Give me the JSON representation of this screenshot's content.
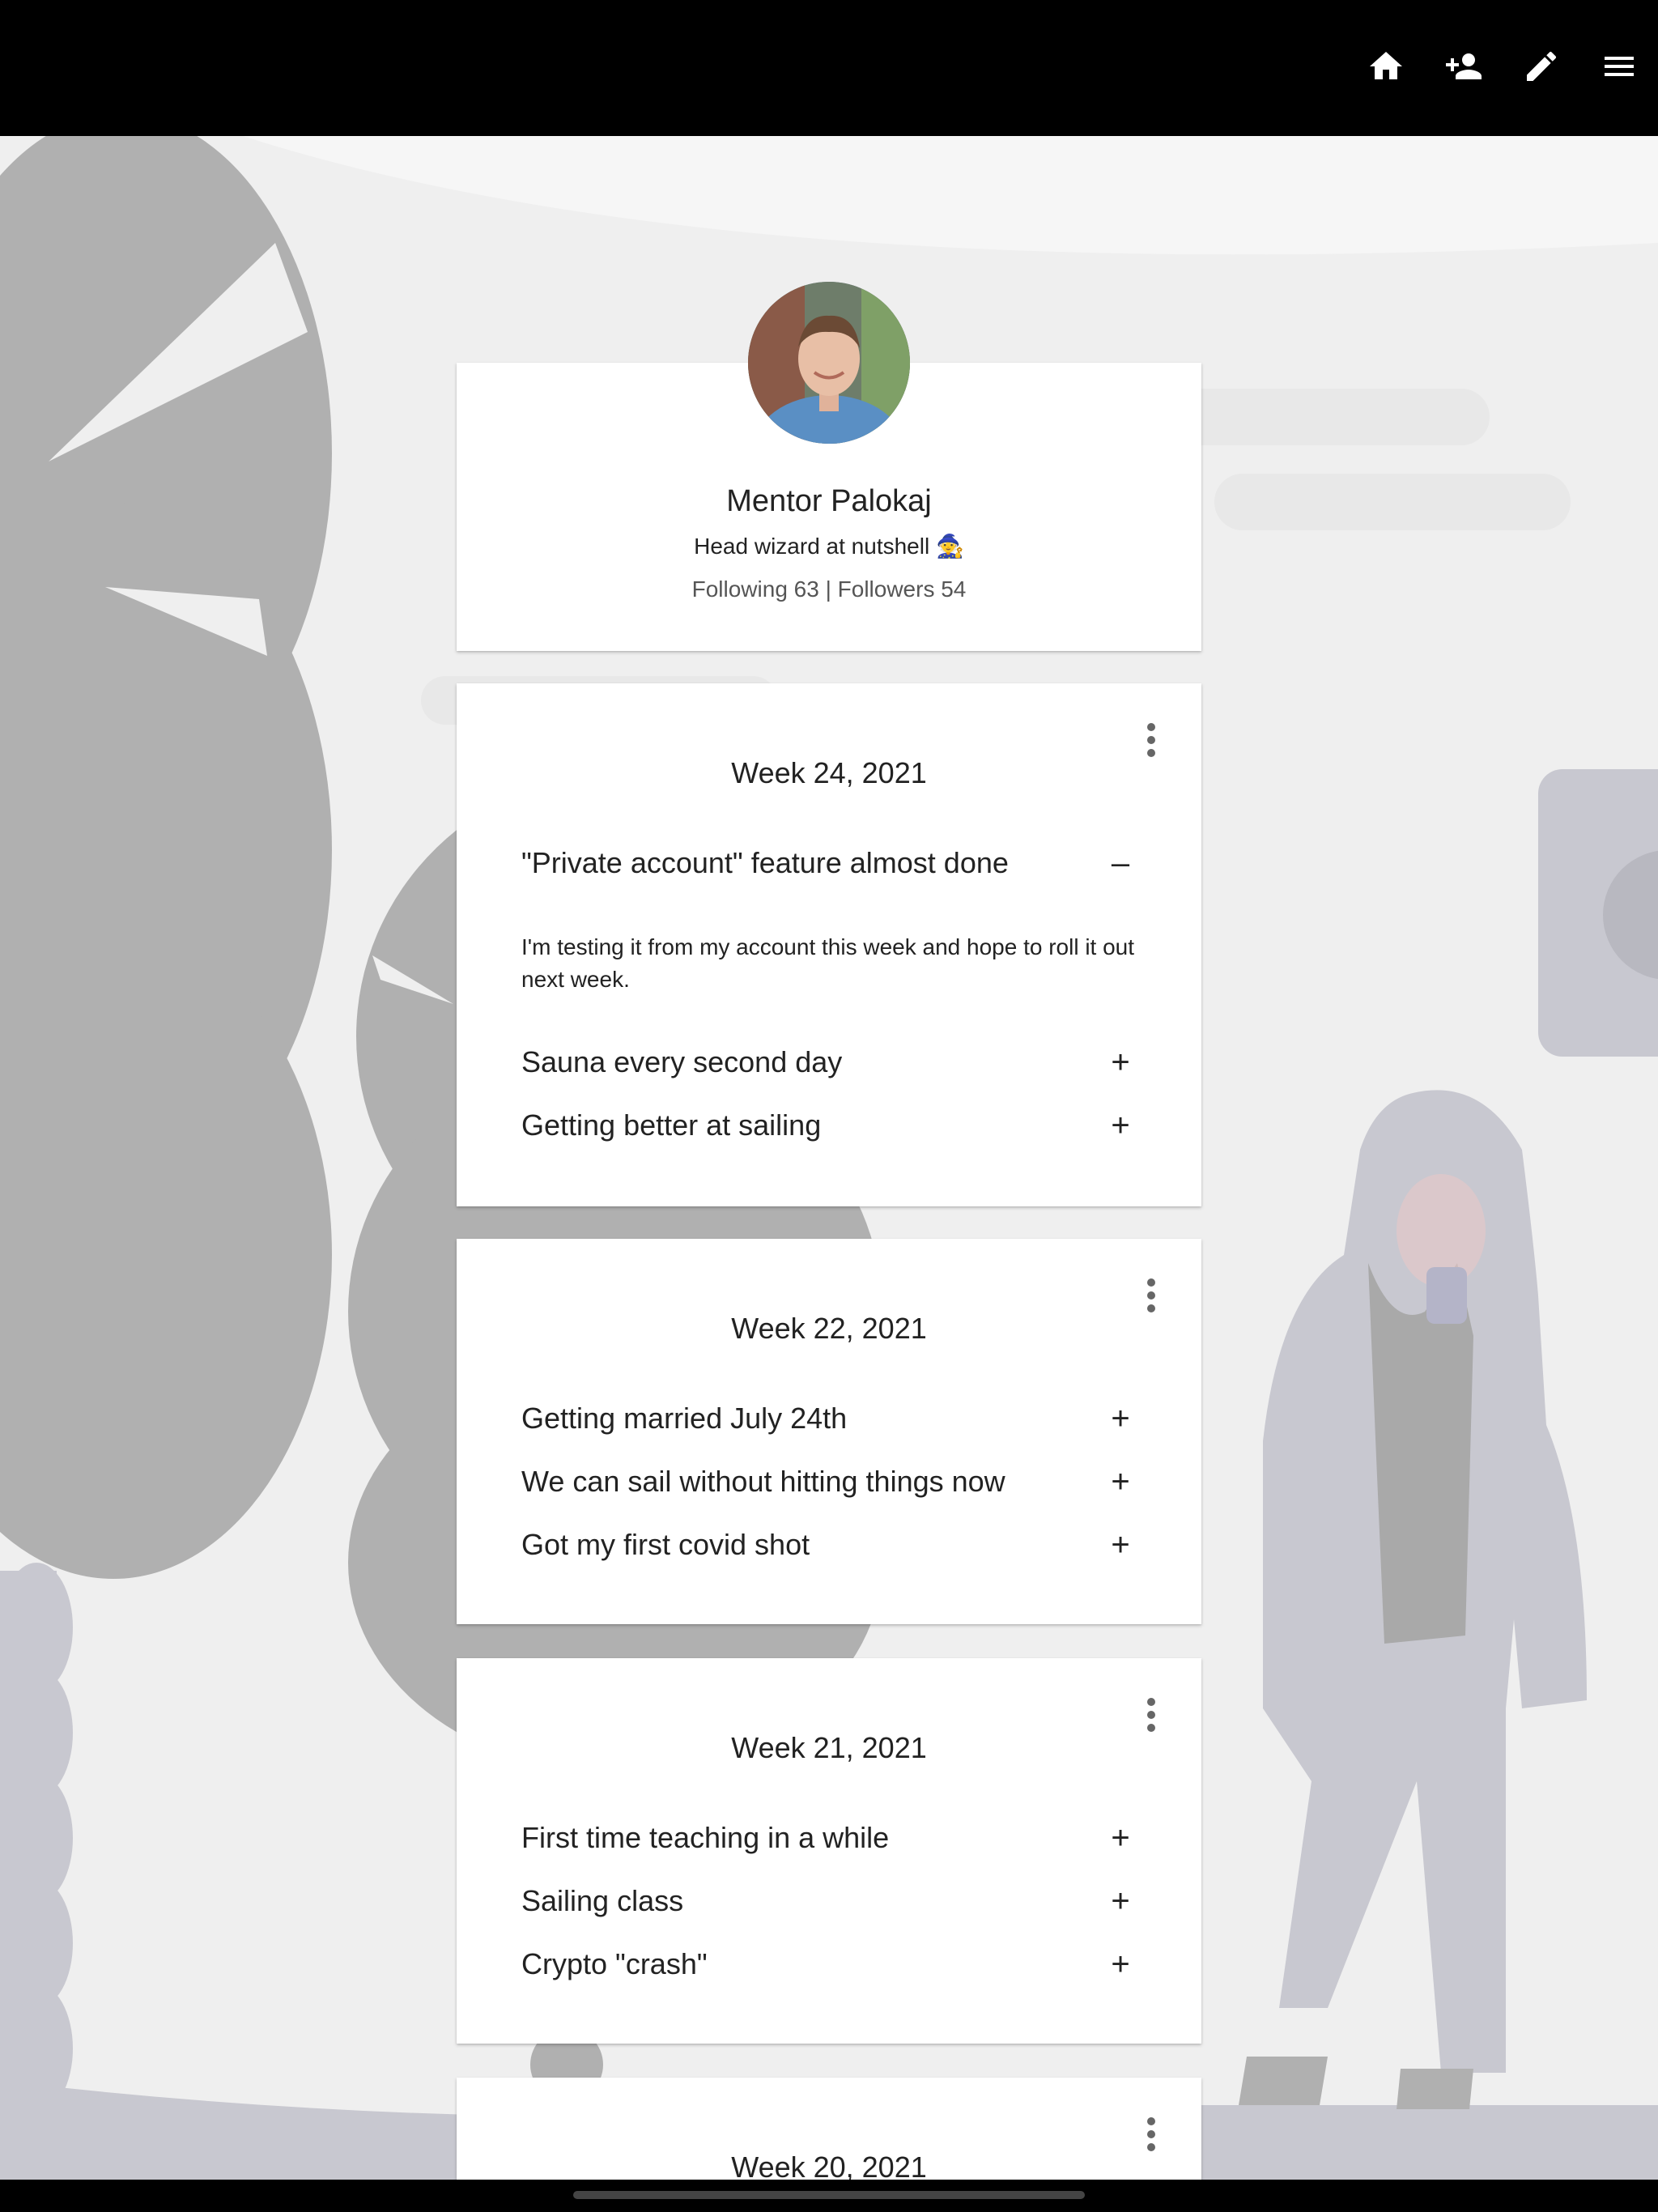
{
  "header": {
    "icons": [
      {
        "name": "home-icon",
        "label": "Home"
      },
      {
        "name": "add-person-icon",
        "label": "Add friend"
      },
      {
        "name": "pencil-icon",
        "label": "Edit"
      },
      {
        "name": "menu-icon",
        "label": "Menu"
      }
    ]
  },
  "profile": {
    "name": "Mentor Palokaj",
    "bio": "Head wizard at nutshell 🧙",
    "stats": "Following 63 | Followers 54"
  },
  "weeks": [
    {
      "title": "Week 24, 2021",
      "items": [
        {
          "title": "\"Private account\" feature almost done",
          "toggle": "–",
          "body": "I'm testing it from my account this week and hope to roll it out next week."
        },
        {
          "title": "Sauna every second day",
          "toggle": "+"
        },
        {
          "title": "Getting better at sailing",
          "toggle": "+"
        }
      ]
    },
    {
      "title": "Week 22, 2021",
      "items": [
        {
          "title": "Getting married July 24th",
          "toggle": "+"
        },
        {
          "title": "We can sail without hitting things now",
          "toggle": "+"
        },
        {
          "title": "Got my first covid shot",
          "toggle": "+"
        }
      ]
    },
    {
      "title": "Week 21, 2021",
      "items": [
        {
          "title": "First time teaching in a while",
          "toggle": "+"
        },
        {
          "title": "Sailing class",
          "toggle": "+"
        },
        {
          "title": "Crypto \"crash\"",
          "toggle": "+"
        }
      ]
    },
    {
      "title": "Week 20, 2021",
      "items": []
    }
  ],
  "colors": {
    "topbar": "#000000",
    "background": "#efefef",
    "card": "#ffffff",
    "illustration_gray": "#b0b0b0",
    "illustration_lavender": "#c8c8d0"
  }
}
